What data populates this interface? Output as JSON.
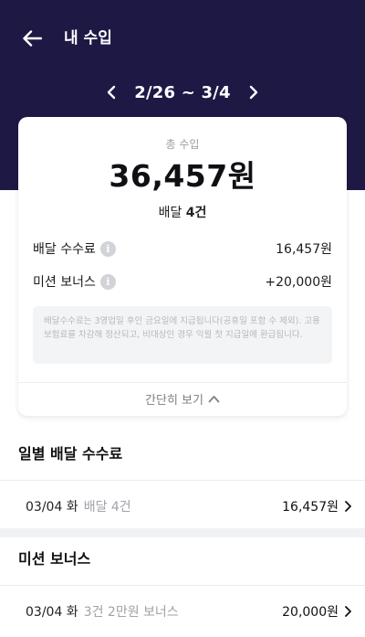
{
  "header": {
    "title": "내 수입",
    "period": "2/26 ~ 3/4"
  },
  "summary": {
    "total_label": "총 수입",
    "total_amount": "36,457원",
    "count_prefix": "배달",
    "count_value": "4건",
    "rows": [
      {
        "label": "배달 수수료",
        "value": "16,457원"
      },
      {
        "label": "미션 보너스",
        "value": "+20,000원"
      }
    ],
    "notice": "배달수수료는 3영업일 후인 금요일에 지급됩니다(공휴일 포함 수 제외). 고용보험료를 차감해 정산되고, 비대상인 경우 익월 첫 지급일에 환급됩니다.",
    "collapse_label": "간단히 보기"
  },
  "daily_fees": {
    "title": "일별 배달 수수료",
    "items": [
      {
        "date": "03/04 화",
        "detail": "배달 4건",
        "amount": "16,457원"
      }
    ]
  },
  "mission_bonus": {
    "title": "미션 보너스",
    "items": [
      {
        "date": "03/04 화",
        "detail": "3건 2만원 보너스",
        "amount": "20,000원"
      }
    ]
  },
  "colors": {
    "header_bg": "#1e1845",
    "page_bg": "#f3f4f6"
  }
}
